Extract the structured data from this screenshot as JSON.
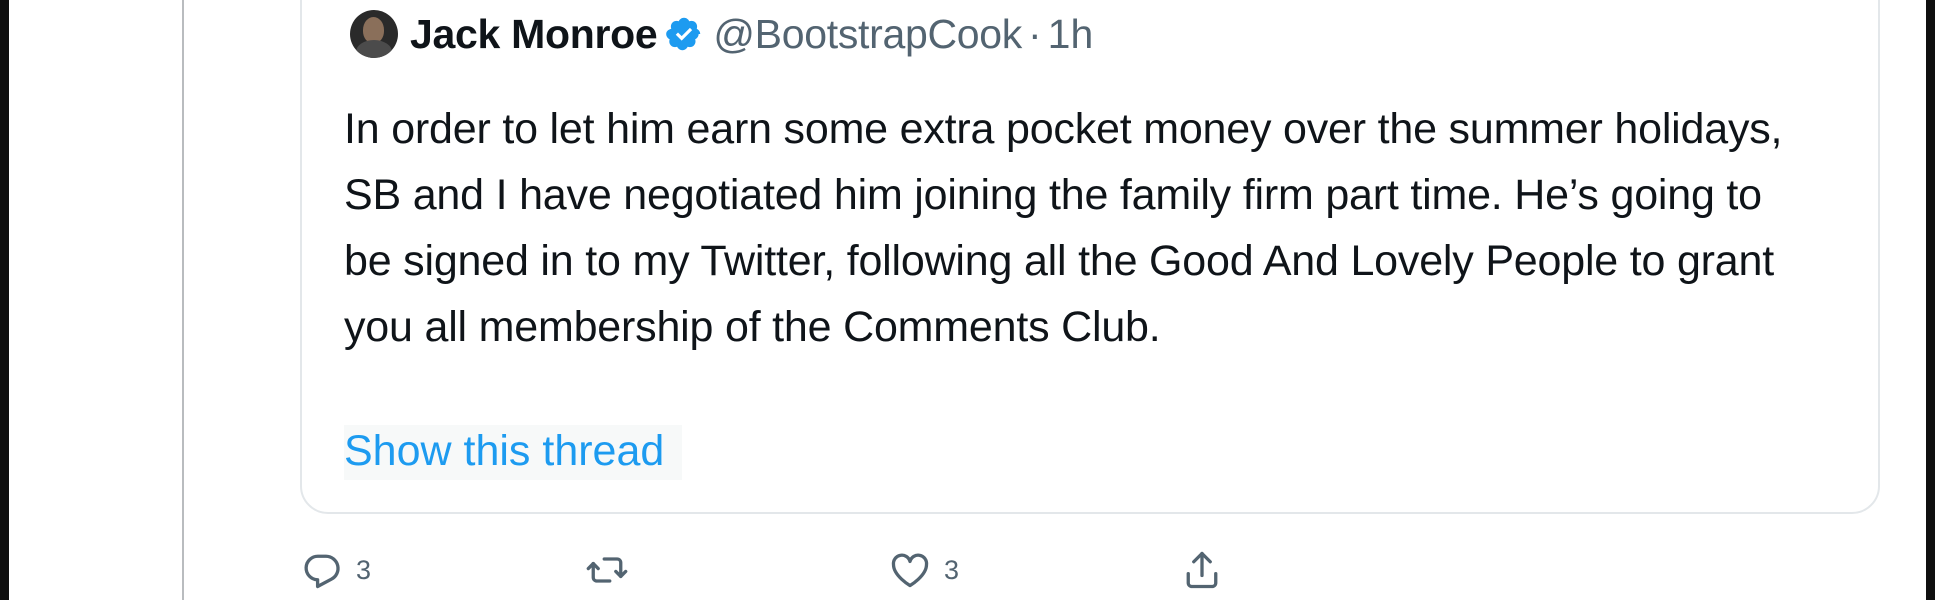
{
  "quoted_tweet": {
    "author_name": "Jack Monroe",
    "verified": true,
    "handle": "@BootstrapCook",
    "separator": "·",
    "time": "1h",
    "text": "In order to let him earn some extra pocket money over the summer holidays, SB and I have negotiated him joining the family firm part time. He’s going to be signed in to my Twitter, following all the Good And Lovely People to grant you all membership of the Comments Club.",
    "show_thread_label": "Show this thread"
  },
  "actions": {
    "reply_count": "3",
    "retweet_count": "",
    "like_count": "3"
  },
  "colors": {
    "accent": "#1d9bf0",
    "text": "#0f1419",
    "muted": "#536471",
    "border": "#e3e7ea"
  },
  "icons": {
    "verified": "verified-badge-icon",
    "reply": "reply-icon",
    "retweet": "retweet-icon",
    "like": "heart-icon",
    "share": "share-icon"
  }
}
